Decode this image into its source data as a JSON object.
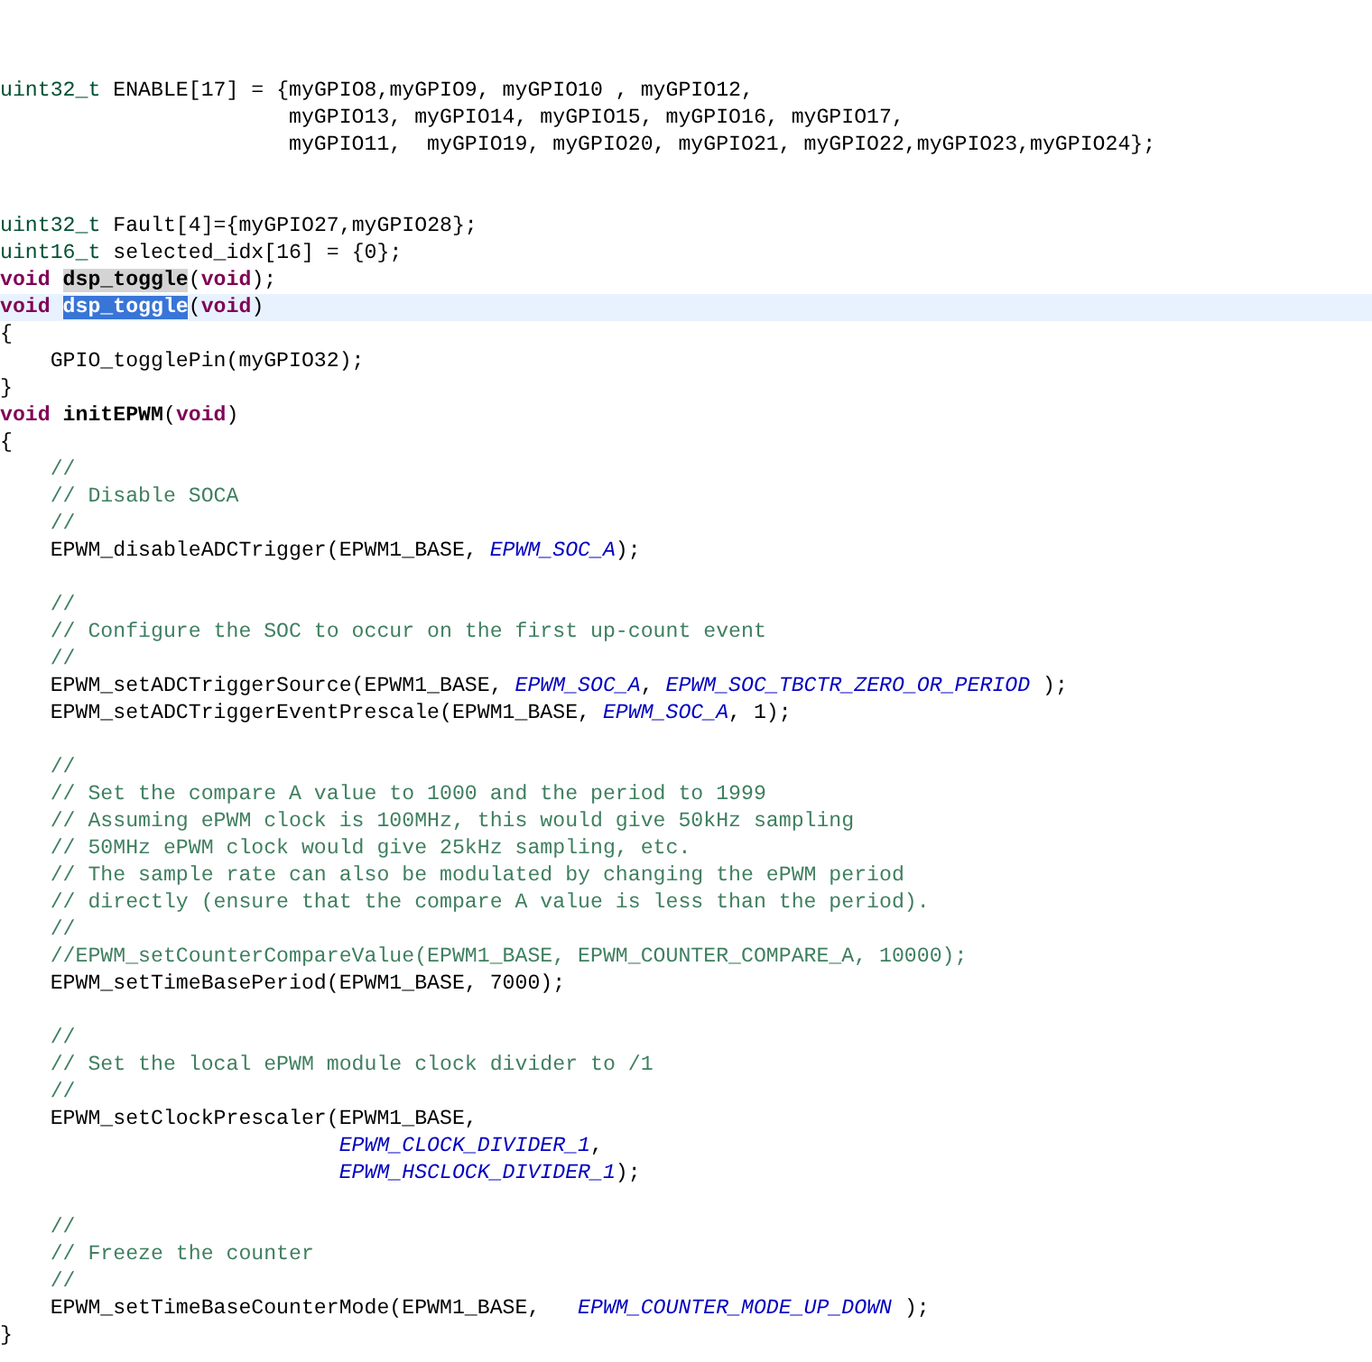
{
  "editor": {
    "lines": [
      {
        "current": false,
        "tokens": [
          {
            "kind": "type",
            "text": "uint32_t"
          },
          {
            "kind": "plain",
            "text": " ENABLE[17] = {myGPIO8,myGPIO9, myGPIO10 , myGPIO12,"
          }
        ]
      },
      {
        "current": false,
        "tokens": [
          {
            "kind": "plain",
            "text": "                       myGPIO13, myGPIO14, myGPIO15, myGPIO16, myGPIO17,"
          }
        ]
      },
      {
        "current": false,
        "tokens": [
          {
            "kind": "plain",
            "text": "                       myGPIO11,  myGPIO19, myGPIO20, myGPIO21, myGPIO22,myGPIO23,myGPIO24};"
          }
        ]
      },
      {
        "current": false
      },
      {
        "current": false
      },
      {
        "current": false,
        "tokens": [
          {
            "kind": "type",
            "text": "uint32_t"
          },
          {
            "kind": "plain",
            "text": " Fault[4]={myGPIO27,myGPIO28};"
          }
        ]
      },
      {
        "current": false,
        "tokens": [
          {
            "kind": "type",
            "text": "uint16_t"
          },
          {
            "kind": "plain",
            "text": " selected_idx[16] = {0};"
          }
        ]
      },
      {
        "current": false,
        "tokens": [
          {
            "kind": "keyword",
            "text": "void "
          },
          {
            "kind": "occurrence",
            "text": "dsp_toggle"
          },
          {
            "kind": "plain",
            "text": "("
          },
          {
            "kind": "keyword",
            "text": "void"
          },
          {
            "kind": "plain",
            "text": ");"
          }
        ]
      },
      {
        "current": true,
        "tokens": [
          {
            "kind": "keyword",
            "text": "void "
          },
          {
            "kind": "selection",
            "text": "dsp_toggle"
          },
          {
            "kind": "plain",
            "text": "("
          },
          {
            "kind": "keyword",
            "text": "void"
          },
          {
            "kind": "plain",
            "text": ")"
          }
        ]
      },
      {
        "current": false,
        "tokens": [
          {
            "kind": "plain",
            "text": "{"
          }
        ]
      },
      {
        "current": false,
        "tokens": [
          {
            "kind": "plain",
            "text": "    GPIO_togglePin(myGPIO32);"
          }
        ]
      },
      {
        "current": false,
        "tokens": [
          {
            "kind": "plain",
            "text": "}"
          }
        ]
      },
      {
        "current": false,
        "tokens": [
          {
            "kind": "keyword",
            "text": "void "
          },
          {
            "kind": "function",
            "text": "initEPWM"
          },
          {
            "kind": "plain",
            "text": "("
          },
          {
            "kind": "keyword",
            "text": "void"
          },
          {
            "kind": "plain",
            "text": ")"
          }
        ]
      },
      {
        "current": false,
        "tokens": [
          {
            "kind": "plain",
            "text": "{"
          }
        ]
      },
      {
        "current": false,
        "tokens": [
          {
            "kind": "comment",
            "text": "    //"
          }
        ]
      },
      {
        "current": false,
        "tokens": [
          {
            "kind": "comment",
            "text": "    // Disable SOCA"
          }
        ]
      },
      {
        "current": false,
        "tokens": [
          {
            "kind": "comment",
            "text": "    //"
          }
        ]
      },
      {
        "current": false,
        "tokens": [
          {
            "kind": "plain",
            "text": "    EPWM_disableADCTrigger(EPWM1_BASE, "
          },
          {
            "kind": "constant",
            "text": "EPWM_SOC_A"
          },
          {
            "kind": "plain",
            "text": ");"
          }
        ]
      },
      {
        "current": false
      },
      {
        "current": false,
        "tokens": [
          {
            "kind": "comment",
            "text": "    //"
          }
        ]
      },
      {
        "current": false,
        "tokens": [
          {
            "kind": "comment",
            "text": "    // Configure the SOC to occur on the first up-count event"
          }
        ]
      },
      {
        "current": false,
        "tokens": [
          {
            "kind": "comment",
            "text": "    //"
          }
        ]
      },
      {
        "current": false,
        "tokens": [
          {
            "kind": "plain",
            "text": "    EPWM_setADCTriggerSource(EPWM1_BASE, "
          },
          {
            "kind": "constant",
            "text": "EPWM_SOC_A"
          },
          {
            "kind": "plain",
            "text": ", "
          },
          {
            "kind": "constant",
            "text": "EPWM_SOC_TBCTR_ZERO_OR_PERIOD"
          },
          {
            "kind": "plain",
            "text": " );"
          }
        ]
      },
      {
        "current": false,
        "tokens": [
          {
            "kind": "plain",
            "text": "    EPWM_setADCTriggerEventPrescale(EPWM1_BASE, "
          },
          {
            "kind": "constant",
            "text": "EPWM_SOC_A"
          },
          {
            "kind": "plain",
            "text": ", 1);"
          }
        ]
      },
      {
        "current": false
      },
      {
        "current": false,
        "tokens": [
          {
            "kind": "comment",
            "text": "    //"
          }
        ]
      },
      {
        "current": false,
        "tokens": [
          {
            "kind": "comment",
            "text": "    // Set the compare A value to 1000 and the period to 1999"
          }
        ]
      },
      {
        "current": false,
        "tokens": [
          {
            "kind": "comment",
            "text": "    // Assuming ePWM clock is 100MHz, this would give 50kHz sampling"
          }
        ]
      },
      {
        "current": false,
        "tokens": [
          {
            "kind": "comment",
            "text": "    // 50MHz ePWM clock would give 25kHz sampling, etc."
          }
        ]
      },
      {
        "current": false,
        "tokens": [
          {
            "kind": "comment",
            "text": "    // The sample rate can also be modulated by changing the ePWM period"
          }
        ]
      },
      {
        "current": false,
        "tokens": [
          {
            "kind": "comment",
            "text": "    // directly (ensure that the compare A value is less than the period)."
          }
        ]
      },
      {
        "current": false,
        "tokens": [
          {
            "kind": "comment",
            "text": "    //"
          }
        ]
      },
      {
        "current": false,
        "tokens": [
          {
            "kind": "comment",
            "text": "    //EPWM_setCounterCompareValue(EPWM1_BASE, EPWM_COUNTER_COMPARE_A, 10000);"
          }
        ]
      },
      {
        "current": false,
        "tokens": [
          {
            "kind": "plain",
            "text": "    EPWM_setTimeBasePeriod(EPWM1_BASE, 7000);"
          }
        ]
      },
      {
        "current": false
      },
      {
        "current": false,
        "tokens": [
          {
            "kind": "comment",
            "text": "    //"
          }
        ]
      },
      {
        "current": false,
        "tokens": [
          {
            "kind": "comment",
            "text": "    // Set the local ePWM module clock divider to /1"
          }
        ]
      },
      {
        "current": false,
        "tokens": [
          {
            "kind": "comment",
            "text": "    //"
          }
        ]
      },
      {
        "current": false,
        "tokens": [
          {
            "kind": "plain",
            "text": "    EPWM_setClockPrescaler(EPWM1_BASE,"
          }
        ]
      },
      {
        "current": false,
        "tokens": [
          {
            "kind": "constant",
            "text": "                           EPWM_CLOCK_DIVIDER_1"
          },
          {
            "kind": "plain",
            "text": ","
          }
        ]
      },
      {
        "current": false,
        "tokens": [
          {
            "kind": "constant",
            "text": "                           EPWM_HSCLOCK_DIVIDER_1"
          },
          {
            "kind": "plain",
            "text": ");"
          }
        ]
      },
      {
        "current": false
      },
      {
        "current": false,
        "tokens": [
          {
            "kind": "comment",
            "text": "    //"
          }
        ]
      },
      {
        "current": false,
        "tokens": [
          {
            "kind": "comment",
            "text": "    // Freeze the counter"
          }
        ]
      },
      {
        "current": false,
        "tokens": [
          {
            "kind": "comment",
            "text": "    //"
          }
        ]
      },
      {
        "current": false,
        "tokens": [
          {
            "kind": "plain",
            "text": "    EPWM_setTimeBaseCounterMode(EPWM1_BASE,   "
          },
          {
            "kind": "constant",
            "text": "EPWM_COUNTER_MODE_UP_DOWN"
          },
          {
            "kind": "plain",
            "text": " );"
          }
        ]
      },
      {
        "current": false,
        "tokens": [
          {
            "kind": "plain",
            "text": "}"
          }
        ]
      }
    ]
  }
}
